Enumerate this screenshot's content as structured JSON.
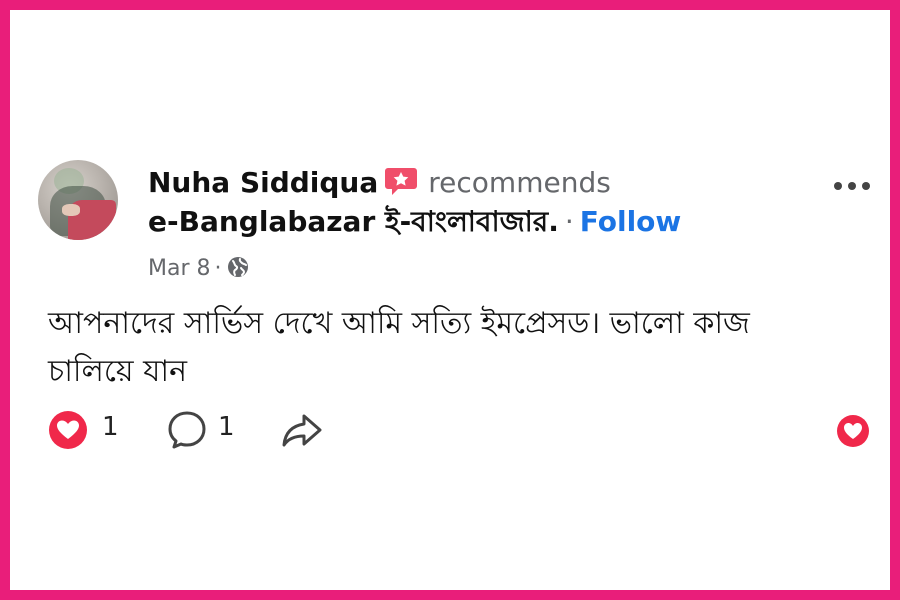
{
  "post": {
    "author": "Nuha Siddiqua",
    "action": "recommends",
    "page_name": "e-Banglabazar ই-বাংলাবাজার.",
    "separator": "·",
    "follow_label": "Follow",
    "date": "Mar 8",
    "meta_separator": "·",
    "audience_icon": "globe-icon",
    "text_line1": "আপনাদের সার্ভিস দেখে আমি সত্যি ইমপ্রেসড। ভালো কাজ",
    "text_line2": "চালিয়ে যান"
  },
  "actions": {
    "reaction_count": "1",
    "comment_count": "1",
    "reaction_icon": "heart-reaction-icon",
    "comment_icon": "comment-icon",
    "share_icon": "share-icon"
  },
  "colors": {
    "frame": "#e91e7a",
    "follow": "#1b74e4",
    "heart": "#f0284a",
    "muted": "#65676b"
  }
}
